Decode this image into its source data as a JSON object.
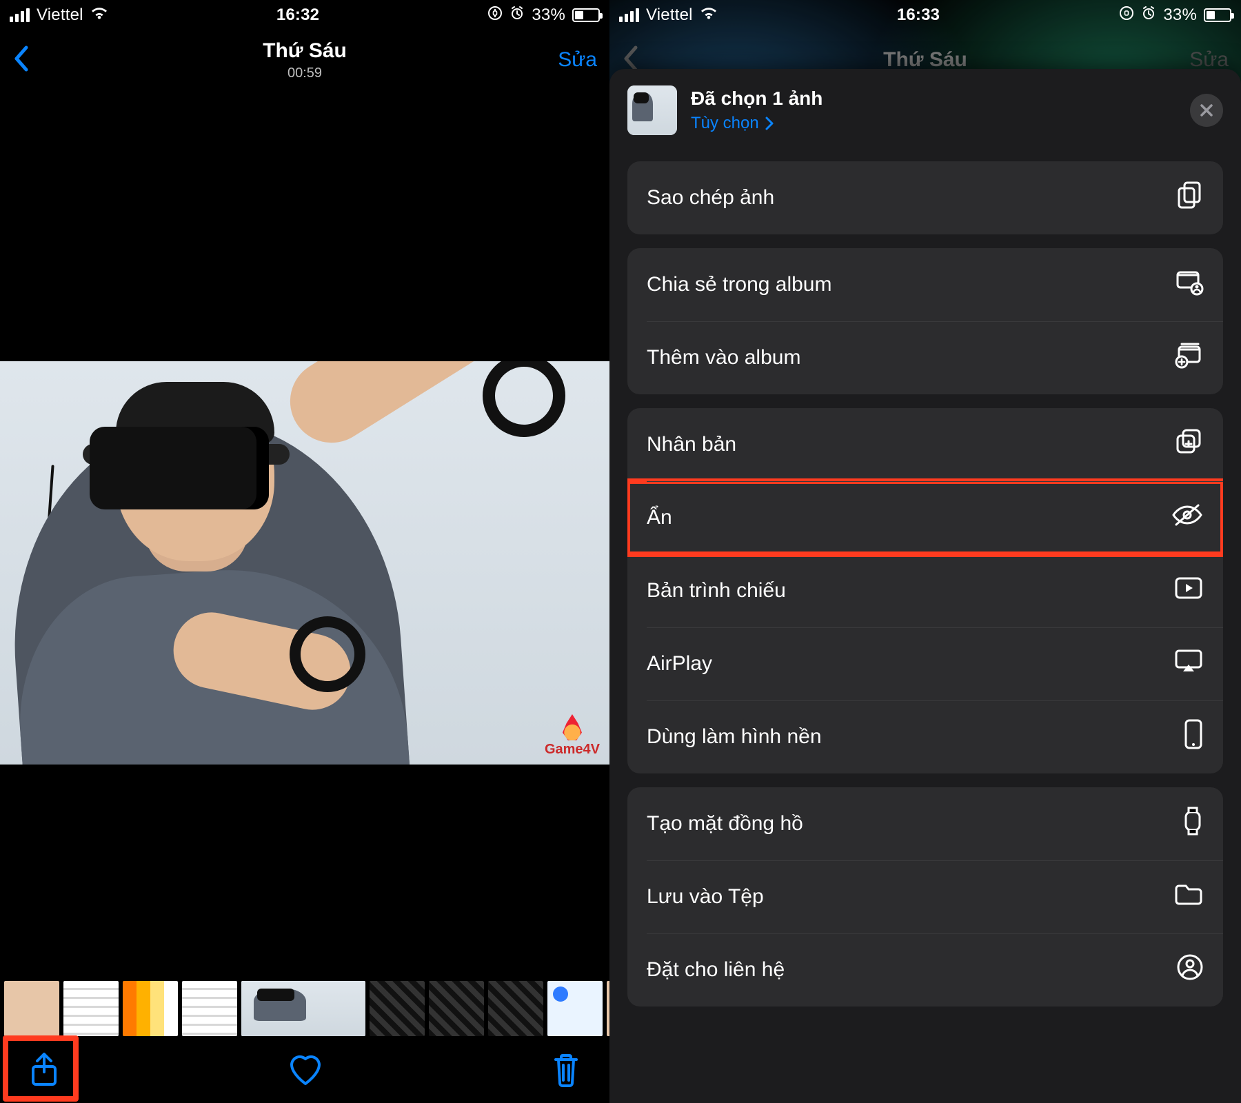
{
  "left": {
    "status": {
      "carrier": "Viettel",
      "time": "16:32",
      "battery_pct": "33%"
    },
    "nav": {
      "title": "Thứ Sáu",
      "subtitle": "00:59",
      "edit": "Sửa"
    },
    "watermark": "Game4V"
  },
  "right": {
    "status": {
      "carrier": "Viettel",
      "time": "16:33",
      "battery_pct": "33%"
    },
    "nav": {
      "title": "Thứ Sáu",
      "edit": "Sửa"
    },
    "sheet": {
      "selected": "Đã chọn 1 ảnh",
      "options": "Tùy chọn",
      "actions": {
        "copy": "Sao chép ảnh",
        "share_album": "Chia sẻ trong album",
        "add_album": "Thêm vào album",
        "duplicate": "Nhân bản",
        "hide": "Ẩn",
        "slideshow": "Bản trình chiếu",
        "airplay": "AirPlay",
        "wallpaper": "Dùng làm hình nền",
        "watchface": "Tạo mặt đồng hồ",
        "save_files": "Lưu vào Tệp",
        "assign_contact": "Đặt cho liên hệ"
      }
    }
  }
}
